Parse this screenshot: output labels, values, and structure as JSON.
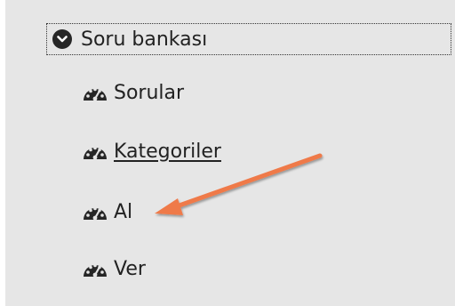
{
  "section": {
    "label": "Soru bankası"
  },
  "items": [
    {
      "label": "Sorular"
    },
    {
      "label": "Kategoriler"
    },
    {
      "label": "Al"
    },
    {
      "label": "Ver"
    }
  ],
  "colors": {
    "background": "#e6e6e6",
    "text": "#222222",
    "annotation_arrow": "#ef7a4a"
  },
  "icons": {
    "section": "chevron-circle-down-icon",
    "item": "dashboard-gauge-icon"
  }
}
